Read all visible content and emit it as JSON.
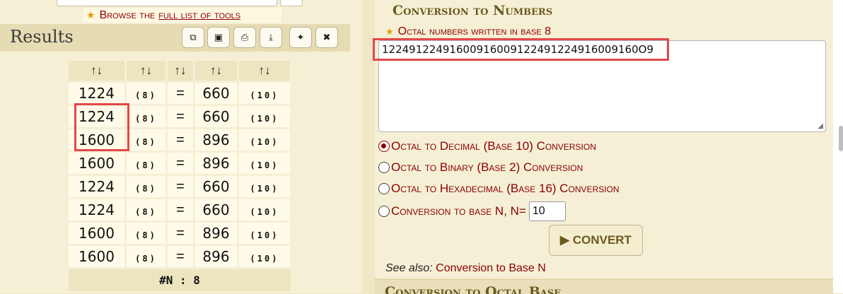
{
  "left": {
    "browse_prefix": "Browse the",
    "browse_link": "full list of tools",
    "results_title": "Results",
    "toolbar": [
      "copy-icon",
      "save-icon",
      "print-icon",
      "download-icon",
      "pin-icon",
      "close-icon"
    ],
    "table": {
      "headers": [
        "↑↓",
        "↑↓",
        "↑↓",
        "↑↓",
        "↑↓"
      ],
      "rows": [
        {
          "octal": "1224",
          "from_base": "(8)",
          "eq": "=",
          "decimal": "660",
          "to_base": "(10)"
        },
        {
          "octal": "1224",
          "from_base": "(8)",
          "eq": "=",
          "decimal": "660",
          "to_base": "(10)"
        },
        {
          "octal": "1600",
          "from_base": "(8)",
          "eq": "=",
          "decimal": "896",
          "to_base": "(10)"
        },
        {
          "octal": "1600",
          "from_base": "(8)",
          "eq": "=",
          "decimal": "896",
          "to_base": "(10)"
        },
        {
          "octal": "1224",
          "from_base": "(8)",
          "eq": "=",
          "decimal": "660",
          "to_base": "(10)"
        },
        {
          "octal": "1224",
          "from_base": "(8)",
          "eq": "=",
          "decimal": "660",
          "to_base": "(10)"
        },
        {
          "octal": "1600",
          "from_base": "(8)",
          "eq": "=",
          "decimal": "896",
          "to_base": "(10)"
        },
        {
          "octal": "1600",
          "from_base": "(8)",
          "eq": "=",
          "decimal": "896",
          "to_base": "(10)"
        }
      ],
      "count": "#N : 8"
    }
  },
  "right": {
    "section_title": "Conversion to Numbers",
    "field_label": "Octal numbers written in base 8",
    "textarea_value": "12249122491600916009122491224916009160O9",
    "options": [
      {
        "label": "Octal to Decimal (Base 10) Conversion",
        "checked": true
      },
      {
        "label": "Octal to Binary (Base 2) Conversion",
        "checked": false
      },
      {
        "label": "Octal to Hexadecimal (Base 16) Conversion",
        "checked": false
      },
      {
        "label": "Conversion to base N, N=",
        "checked": false
      }
    ],
    "base_n_value": "10",
    "convert_label": "▶ CONVERT",
    "see_also_prefix": "See also:",
    "see_also_link": "Conversion to Base N",
    "next_section_title": "Conversion to Octal Base"
  },
  "colors": {
    "accent_dark_red": "#8b0000",
    "highlight_box": "#e34848",
    "title_brown": "#6b5a1e",
    "panel_bg": "#f5efd6"
  }
}
